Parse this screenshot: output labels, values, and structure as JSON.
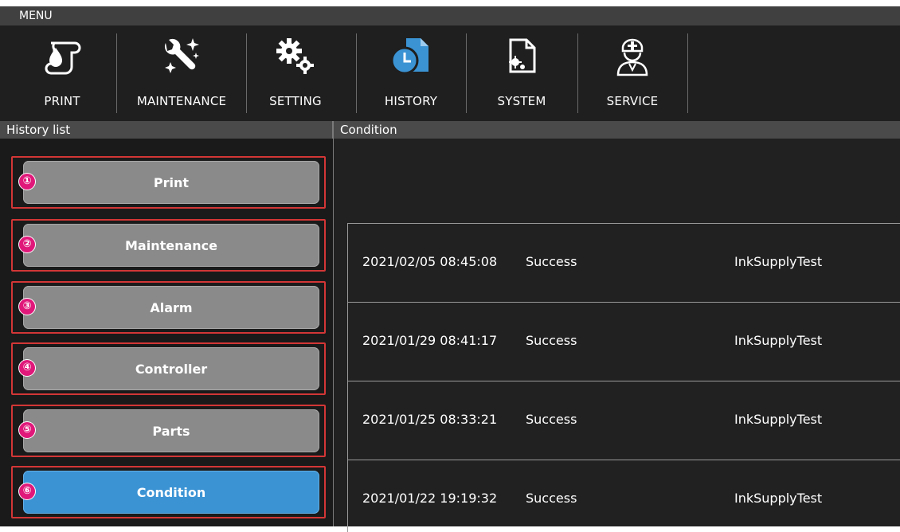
{
  "menu_title": "MENU",
  "toolbar": [
    {
      "label": "PRINT",
      "icon": "print-icon"
    },
    {
      "label": "MAINTENANCE",
      "icon": "maintenance-icon"
    },
    {
      "label": "SETTING",
      "icon": "setting-icon"
    },
    {
      "label": "HISTORY",
      "icon": "history-icon"
    },
    {
      "label": "SYSTEM",
      "icon": "system-icon"
    },
    {
      "label": "SERVICE",
      "icon": "service-icon"
    }
  ],
  "history_list": {
    "title": "History list",
    "items": [
      {
        "marker": "①",
        "label": "Print"
      },
      {
        "marker": "②",
        "label": "Maintenance"
      },
      {
        "marker": "③",
        "label": "Alarm"
      },
      {
        "marker": "④",
        "label": "Controller"
      },
      {
        "marker": "⑤",
        "label": "Parts"
      },
      {
        "marker": "⑥",
        "label": "Condition"
      }
    ],
    "active_index": 5
  },
  "condition": {
    "title": "Condition",
    "rows": [
      {
        "date": "2021/02/05 08:45:08",
        "result": "Success",
        "name": "InkSupplyTest"
      },
      {
        "date": "2021/01/29 08:41:17",
        "result": "Success",
        "name": "InkSupplyTest"
      },
      {
        "date": "2021/01/25 08:33:21",
        "result": "Success",
        "name": "InkSupplyTest"
      },
      {
        "date": "2021/01/22 19:19:32",
        "result": "Success",
        "name": "InkSupplyTest"
      }
    ]
  },
  "colors": {
    "accent": "#3b93d4",
    "highlight_outline": "#d33636",
    "marker": "#e0187a"
  }
}
